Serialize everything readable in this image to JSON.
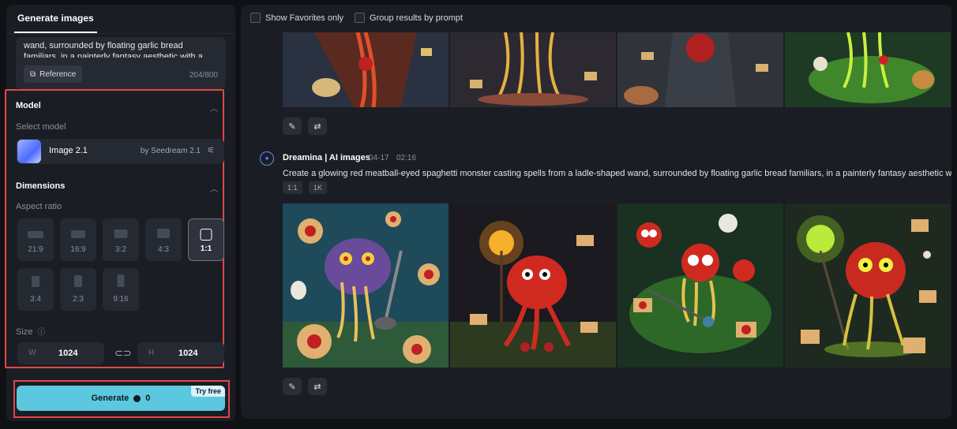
{
  "left_panel": {
    "tab_label": "Generate images",
    "prompt_text": "wand, surrounded by floating garlic bread familiars, in a painterly fantasy aesthetic with a",
    "reference_label": "Reference",
    "char_counter": "204/800",
    "model": {
      "section_title": "Model",
      "select_label": "Select model",
      "name": "Image 2.1",
      "by": "by Seedream 2.1"
    },
    "dimensions": {
      "section_title": "Dimensions",
      "aspect_label": "Aspect ratio",
      "ratios": [
        "21:9",
        "16:9",
        "3:2",
        "4:3",
        "1:1",
        "3:4",
        "2:3",
        "9:16"
      ],
      "selected_ratio": "1:1",
      "size_label": "Size",
      "width_key": "W",
      "width_value": "1024",
      "height_key": "H",
      "height_value": "1024"
    },
    "generate_label": "Generate",
    "generate_cost": "0",
    "try_free_label": "Try free"
  },
  "main": {
    "show_favorites_label": "Show Favorites only",
    "group_results_label": "Group results by prompt",
    "result": {
      "source_name": "Dreamina | AI images",
      "date": "04-17",
      "time": "02:16",
      "prompt": "Create a glowing red meatball-eyed spaghetti monster casting spells from a ladle-shaped wand, surrounded by floating garlic bread familiars, in a painterly fantasy aesthetic with a",
      "tag_ratio": "1:1",
      "tag_res": "1K"
    }
  },
  "colors": {
    "accent_generate": "#5cc8e0",
    "highlight_outline": "#e04848",
    "panel_bg": "#1a1d24",
    "page_bg": "#0f1115"
  }
}
